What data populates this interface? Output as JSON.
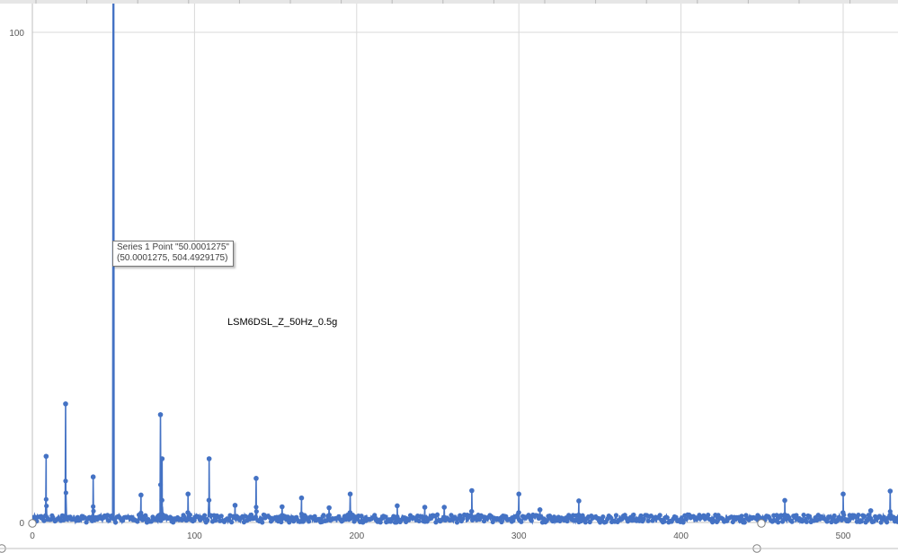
{
  "chart_data": {
    "type": "line",
    "title": "",
    "annotation": "LSM6DSL_Z_50Hz_0.5g",
    "xlabel": "",
    "ylabel": "",
    "xlim": [
      0,
      535
    ],
    "ylim": [
      0,
      100
    ],
    "x_ticks": [
      "0",
      "100",
      "200",
      "300",
      "400",
      "500"
    ],
    "y_ticks": [
      "0",
      "100"
    ],
    "grid": true,
    "legend": "none",
    "series": [
      {
        "color": "#4472C4",
        "peaks": [
          {
            "x": 8.5,
            "y": 13.5
          },
          {
            "x": 20.5,
            "y": 24.2
          },
          {
            "x": 37.5,
            "y": 9.3
          },
          {
            "x": 50.0,
            "y": 504.5
          },
          {
            "x": 67.0,
            "y": 5.6
          },
          {
            "x": 79.0,
            "y": 22.0
          },
          {
            "x": 80.0,
            "y": 13.0
          },
          {
            "x": 96.0,
            "y": 5.8
          },
          {
            "x": 109.0,
            "y": 13.0
          },
          {
            "x": 125.0,
            "y": 3.5
          },
          {
            "x": 138.0,
            "y": 9.0
          },
          {
            "x": 154.0,
            "y": 3.2
          },
          {
            "x": 166.0,
            "y": 5.0
          },
          {
            "x": 183.0,
            "y": 3.0
          },
          {
            "x": 196.0,
            "y": 5.8
          },
          {
            "x": 225.0,
            "y": 3.4
          },
          {
            "x": 242.0,
            "y": 3.1
          },
          {
            "x": 254.0,
            "y": 3.1
          },
          {
            "x": 271.0,
            "y": 6.5
          },
          {
            "x": 300.0,
            "y": 5.8
          },
          {
            "x": 313.0,
            "y": 2.6
          },
          {
            "x": 337.0,
            "y": 4.4
          },
          {
            "x": 464.0,
            "y": 4.5
          },
          {
            "x": 500.0,
            "y": 5.8
          },
          {
            "x": 517.0,
            "y": 2.4
          },
          {
            "x": 529.0,
            "y": 6.4
          }
        ]
      }
    ]
  },
  "tooltip": {
    "line1": "Series 1 Point \"50.0001275\"",
    "line2": "(50.0001275, 504.4929175)"
  }
}
